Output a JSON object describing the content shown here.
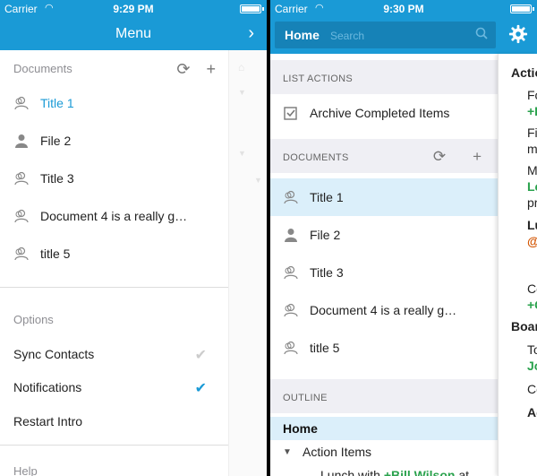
{
  "left": {
    "status": {
      "carrier": "Carrier",
      "time": "9:29 PM"
    },
    "nav": {
      "title": "Menu"
    },
    "documents": {
      "header": "Documents",
      "items": [
        {
          "label": "Title 1",
          "icon": "shared-people-icon",
          "active": true
        },
        {
          "label": "File 2",
          "icon": "person-icon"
        },
        {
          "label": "Title 3",
          "icon": "shared-people-icon"
        },
        {
          "label": "Document 4 is a really g…",
          "icon": "shared-people-icon"
        },
        {
          "label": "title 5",
          "icon": "shared-people-icon"
        }
      ]
    },
    "options": {
      "header": "Options",
      "sync_contacts": "Sync Contacts",
      "notifications": "Notifications",
      "restart_intro": "Restart Intro"
    },
    "help": {
      "header": "Help"
    }
  },
  "right": {
    "status": {
      "carrier": "Carrier",
      "time": "9:30 PM"
    },
    "search": {
      "home_label": "Home",
      "placeholder": "Search"
    },
    "list_actions": {
      "header": "LIST ACTIONS",
      "archive": "Archive Completed Items"
    },
    "documents": {
      "header": "DOCUMENTS",
      "items": [
        {
          "label": "Title 1",
          "icon": "shared-people-icon",
          "active": true
        },
        {
          "label": "File 2",
          "icon": "person-icon"
        },
        {
          "label": "Title 3",
          "icon": "shared-people-icon"
        },
        {
          "label": "Document 4 is a really g…",
          "icon": "shared-people-icon"
        },
        {
          "label": "title 5",
          "icon": "shared-people-icon"
        }
      ]
    },
    "outline": {
      "header": "OUTLINE",
      "home": "Home",
      "action_items": "Action Items",
      "lunch_prefix": "Lunch with",
      "lunch_mention": "+Bill Wilson",
      "lunch_suffix": "at"
    },
    "side": {
      "acti": "Actio",
      "fo": "Fo",
      "plus_l": "+L",
      "fi": "Fi",
      "m": "m",
      "mi": "M",
      "le": "Le",
      "pr": "pr",
      "lu": "Lu",
      "at": "@",
      "co1": "Co",
      "plus_c": "+C",
      "boar": "Boar",
      "to": "To",
      "jo": "Jo",
      "co2": "Co",
      "ag": "Ag"
    }
  },
  "colors": {
    "accent": "#1a9ad6",
    "mention": "#2aa24d"
  }
}
